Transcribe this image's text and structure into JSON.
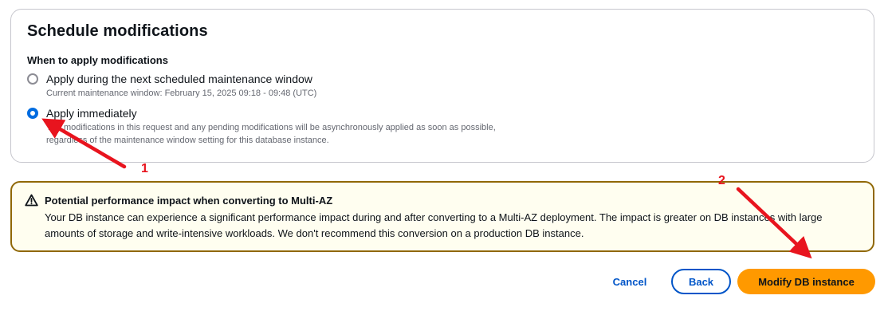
{
  "schedule": {
    "title": "Schedule modifications",
    "when_label": "When to apply modifications",
    "options": [
      {
        "label": "Apply during the next scheduled maintenance window",
        "description": "Current maintenance window: February 15, 2025 09:18 - 09:48 (UTC)",
        "selected": false
      },
      {
        "label": "Apply immediately",
        "description_line1": "The modifications in this request and any pending modifications will be asynchronously applied as soon as possible,",
        "description_line2": "regardless of the maintenance window setting for this database instance.",
        "selected": true
      }
    ]
  },
  "alert": {
    "icon": "warning-triangle-icon",
    "title": "Potential performance impact when converting to Multi-AZ",
    "body": "Your DB instance can experience a significant performance impact during and after converting to a Multi-AZ deployment. The impact is greater on DB instances with large amounts of storage and write-intensive workloads. We don't recommend this conversion on a production DB instance."
  },
  "actions": {
    "cancel_label": "Cancel",
    "back_label": "Back",
    "primary_label": "Modify DB instance"
  },
  "annotations": {
    "arrow1_label": "1",
    "arrow2_label": "2",
    "color": "#e8141e"
  },
  "colors": {
    "primary_button": "#ff9900",
    "link_blue": "#0055c8",
    "radio_selected": "#006ce0",
    "warning_border": "#906806",
    "warning_bg": "#fffef0"
  }
}
